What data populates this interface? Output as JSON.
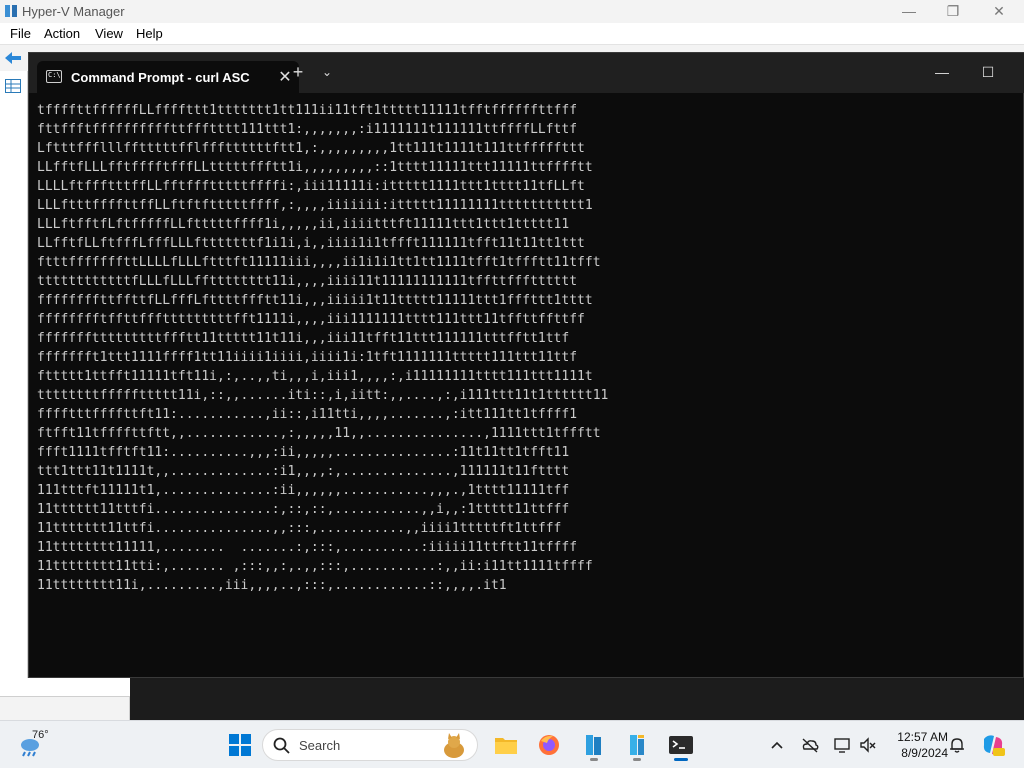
{
  "hyperv": {
    "title": "Hyper-V Manager",
    "menu": [
      "File",
      "Action",
      "View",
      "Help"
    ]
  },
  "terminal": {
    "tab_title": "Command Prompt - curl  ASC",
    "icon_text": "C:\\",
    "lines": [
      "tffffttffffffLLffffttt1ttttttt1tt111ii11tft1ttttt11111tfftffffffttfff",
      "fttffftffffffffffttffftttt111ttt1:,,,,,,,:i1111111t111111ttffffLLfttf",
      "Lftttffflllfftttttfflfffttttttftt1,:,,,,,,,,,1tt111t1111t111ttfffffttt",
      "LLfftfLLLfftfffftfffLLtttttffftt1i,,,,,,,,,::1tttt11111ttt11111ttfffftt",
      "LLLLftffftttffLLfftffftttttffffi:,iii11111i:ittttt1111ttt1tttt11tfLLft",
      "LLLftttffffttffLLftftftttttffff,:,,,,iiiiiii:ittttt11111111ttttttttttt1",
      "LLLftfftfLftfffffLLftttttffff1i,,,,,ii,iiiitttft11111ttt1ttt1ttttt11",
      "LLfftfLLftfffLfffLLLftttttttf1i1i,i,,iiii1i1tffft111111tfft11t11tt1ttt",
      "ftttfffffffttLLLLfLLLftttft11111iii,,,,ii1i1i1tt1tt1111tfft1tffftt11tfft",
      "ttttttttttttfLLLfLLLfftttttttt11i,,,,iiii11t11111111111tffttffftttttt",
      "ffffffffttffttfLLfffLfttttffftt11i,,,iiiii1t11ttttt11111ttt1fffttt1tttt",
      "fffffffftffttffftttttttttfft1111i,,,,iii1111111tttt111ttt11tffttffttff",
      "ffffffftttttttttffftt11ttttt11t11i,,,iii11tfft11ttt111111tttfftt1ttf",
      "ffffffft1ttt1111ffff1tt11iiii1iiii,iiii1i:1tft1111111ttttt111ttt11ttf",
      "fttttt1ttfft11111tft11i,:,..,,ti,,,i,iii1,,,,:,i11111111tttt111ttt1111t",
      "ttttttttfffffttttt11i,::,,......iti::,i,iitt:,,....,:,i111ttt11t1tttttt11",
      "fffftttffffttft11:...........,ii::,i11tti,,,,.......,:itt111tt1tffff1",
      "ftfft11tffffttftt,,............,:,,,,,11,,...............,1111ttt1tffftt",
      "ffft1111tfftft11:..........,,,:ii,,,,,...............:11t11tt1tfft11",
      "ttt1ttt11t1111t,,.............:i1,,,,:,..............,111111t11ftttt",
      "111tttft11111t1,..............:ii,,,,,,...........,,,.,1tttt11111tff",
      "11tttttt11tttfi...............:,::,::,...........,,i,,:1ttttt11ttfff",
      "11ttttttt11ttfi...............,,:::,...........,,iiii1tttttft1ttfff",
      "11tttttttt11111,........  .......:,:::,..........:iiiii11ttftt11tffff",
      "11tttttttt11tti:,....... ,:::,,:,.,,:::,...........:,,ii:i11tt1111tffff",
      "11tttttttt11i,.........,iii,,,,..,:::,............::,,,,.it1"
    ]
  },
  "taskbar": {
    "temperature": "76°",
    "search_placeholder": "Search",
    "time": "12:57 AM",
    "date": "8/9/2024"
  },
  "colors": {
    "terminal_bg": "#0c0c0c",
    "terminal_text": "#cccccc",
    "tabbar_bg": "#202020",
    "taskbar_bg": "#eef1f4",
    "accent": "#0067c0"
  }
}
